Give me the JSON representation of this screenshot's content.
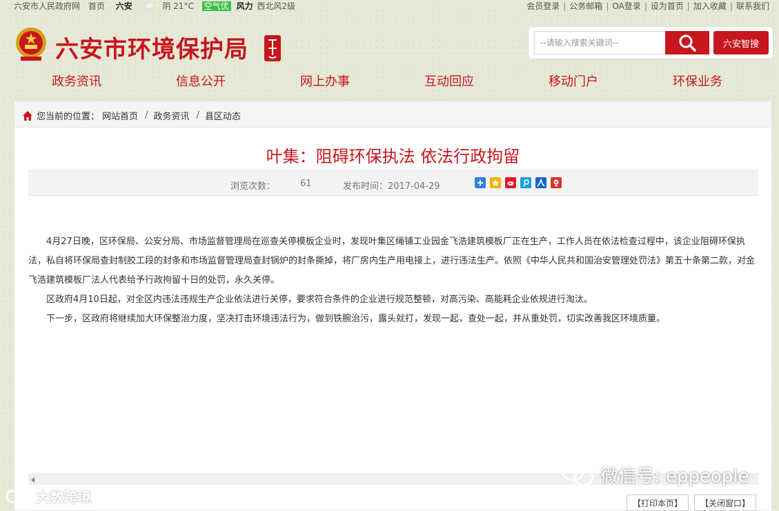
{
  "topbar": {
    "site_link": "六安市人民政府网",
    "home_link": "首页",
    "city": "六安",
    "weather": "阴 21°C",
    "aqi": "空气优",
    "wind_label": "风力",
    "wind_value": "西北风2级",
    "links": [
      "会员登录",
      "公务邮箱",
      "OA登录",
      "设为首页",
      "加入收藏",
      "联系我们"
    ]
  },
  "header": {
    "title": "六安市环境保护局",
    "search_placeholder": "--请输入搜索关键词--",
    "zhisou_label": "六安智搜"
  },
  "nav": {
    "items": [
      "政务资讯",
      "信息公开",
      "网上办事",
      "互动回应",
      "移动门户",
      "环保业务"
    ]
  },
  "breadcrumb": {
    "prefix": "您当前的位置：",
    "items": [
      "网站首页",
      "政务资讯",
      "县区动态"
    ]
  },
  "article": {
    "title": "叶集：阻碍环保执法 依法行政拘留",
    "views_label": "浏览次数：",
    "views": "61",
    "date_label": "发布时间：2017-04-29",
    "paragraphs": [
      "4月27日晚，区环保局、公安分局、市场监督管理局在巡查关停模板企业时，发现叶集区绳铺工业园金飞浩建筑模板厂正在生产，工作人员在依法检查过程中，该企业阻碍环保执法，私自将环保局查封制胶工段的封条和市场监督管理局查封锅炉的封条撕掉，将厂房内生产用电接上，进行违法生产。依照《中华人民共和国治安管理处罚法》第五十条第二款，对金飞浩建筑模板厂法人代表给予行政拘留十日的处罚，永久关停。",
      "区政府4月10日起，对全区内违法违规生产企业依法进行关停，要求符合条件的企业进行规范整顿，对高污染、高能耗企业依规进行淘汰。",
      "下一步，区政府将继续加大环保整治力度，坚决打击环境违法行为，做到铁腕治污，露头就打，发现一起，查处一起，并从重处罚，切实改善我区环境质量。"
    ]
  },
  "footer_buttons": {
    "print": "【打印本页】",
    "close": "【关闭窗口】"
  },
  "watermarks": {
    "left": "大数跨境",
    "right": "微信号: eppeople"
  },
  "colors": {
    "brand_red": "#c8161d",
    "aqi_green": "#3cbf4a"
  }
}
